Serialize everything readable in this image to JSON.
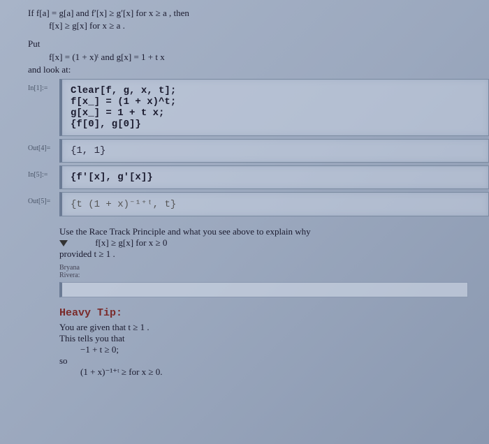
{
  "intro": {
    "line1_a": "If f[a] = g[a]  and f′[x] ≥ g′[x]  for x ≥ a  , then",
    "line1_b": "f[x] ≥ g[x]  for x ≥ a  .",
    "put": "Put",
    "defs": "f[x] = (1 + x)ᵗ   and g[x] = 1 + t x",
    "look": "and look at:"
  },
  "cells": {
    "in1_label": "In[1]:=",
    "in1_code": "Clear[f, g, x, t];\nf[x_] = (1 + x)^t;\ng[x_] = 1 + t x;\n{f[0], g[0]}",
    "out4_label": "Out[4]=",
    "out4_code": "{1, 1}",
    "in5_label": "In[5]:=",
    "in5_code": "{f'[x], g'[x]}",
    "out5_label": "Out[5]=",
    "out5_code": "{t (1 + x)⁻¹⁺ᵗ, t}"
  },
  "question": {
    "line1": "Use the Race Track Principle and what you see above to explain why",
    "line2": "f[x] ≥ g[x]  for x ≥ 0",
    "line3": "provided t ≥ 1 .",
    "author": "Bryana\nRivera:"
  },
  "tip": {
    "heading": "Heavy Tip:",
    "line1": "You are given that t ≥ 1  .",
    "line2": "This tells you that",
    "line3": "−1 + t ≥ 0;",
    "line4": "so",
    "line5": "(1 + x)⁻¹⁺ᵗ ≥  for x ≥ 0."
  }
}
